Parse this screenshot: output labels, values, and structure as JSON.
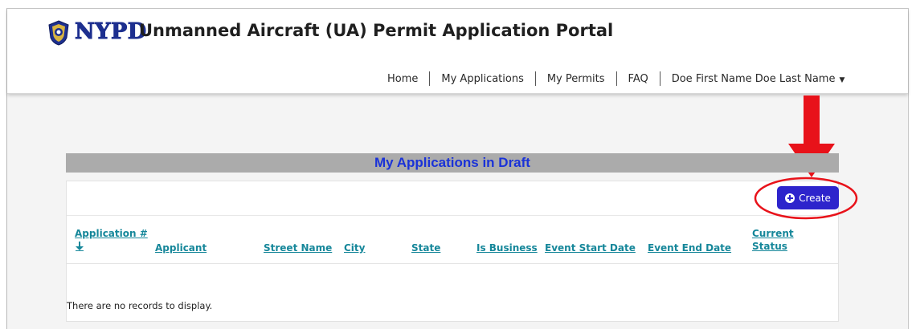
{
  "header": {
    "brand": "NYPD",
    "title": "Unmanned Aircraft (UA) Permit Application Portal"
  },
  "nav": {
    "items": [
      "Home",
      "My Applications",
      "My Permits",
      "FAQ"
    ],
    "user": "Doe First Name Doe Last Name"
  },
  "panel": {
    "title": "My Applications in Draft",
    "create_label": "Create",
    "columns": {
      "application": "Application #",
      "applicant": "Applicant",
      "street": "Street Name",
      "city": "City",
      "state": "State",
      "business": "Is Business",
      "start": "Event Start Date",
      "end": "Event End Date",
      "status_line1": "Current",
      "status_line2": "Status"
    },
    "empty_text": "There are no records to display."
  },
  "colors": {
    "accent": "#2d24cc",
    "link": "#16879a",
    "annotation": "#e8121a",
    "brand": "#1d2f8f"
  },
  "icons": [
    "nypd-badge-icon",
    "chevron-down-icon",
    "plus-circle-icon",
    "sort-down-icon",
    "annotation-arrow-icon"
  ]
}
